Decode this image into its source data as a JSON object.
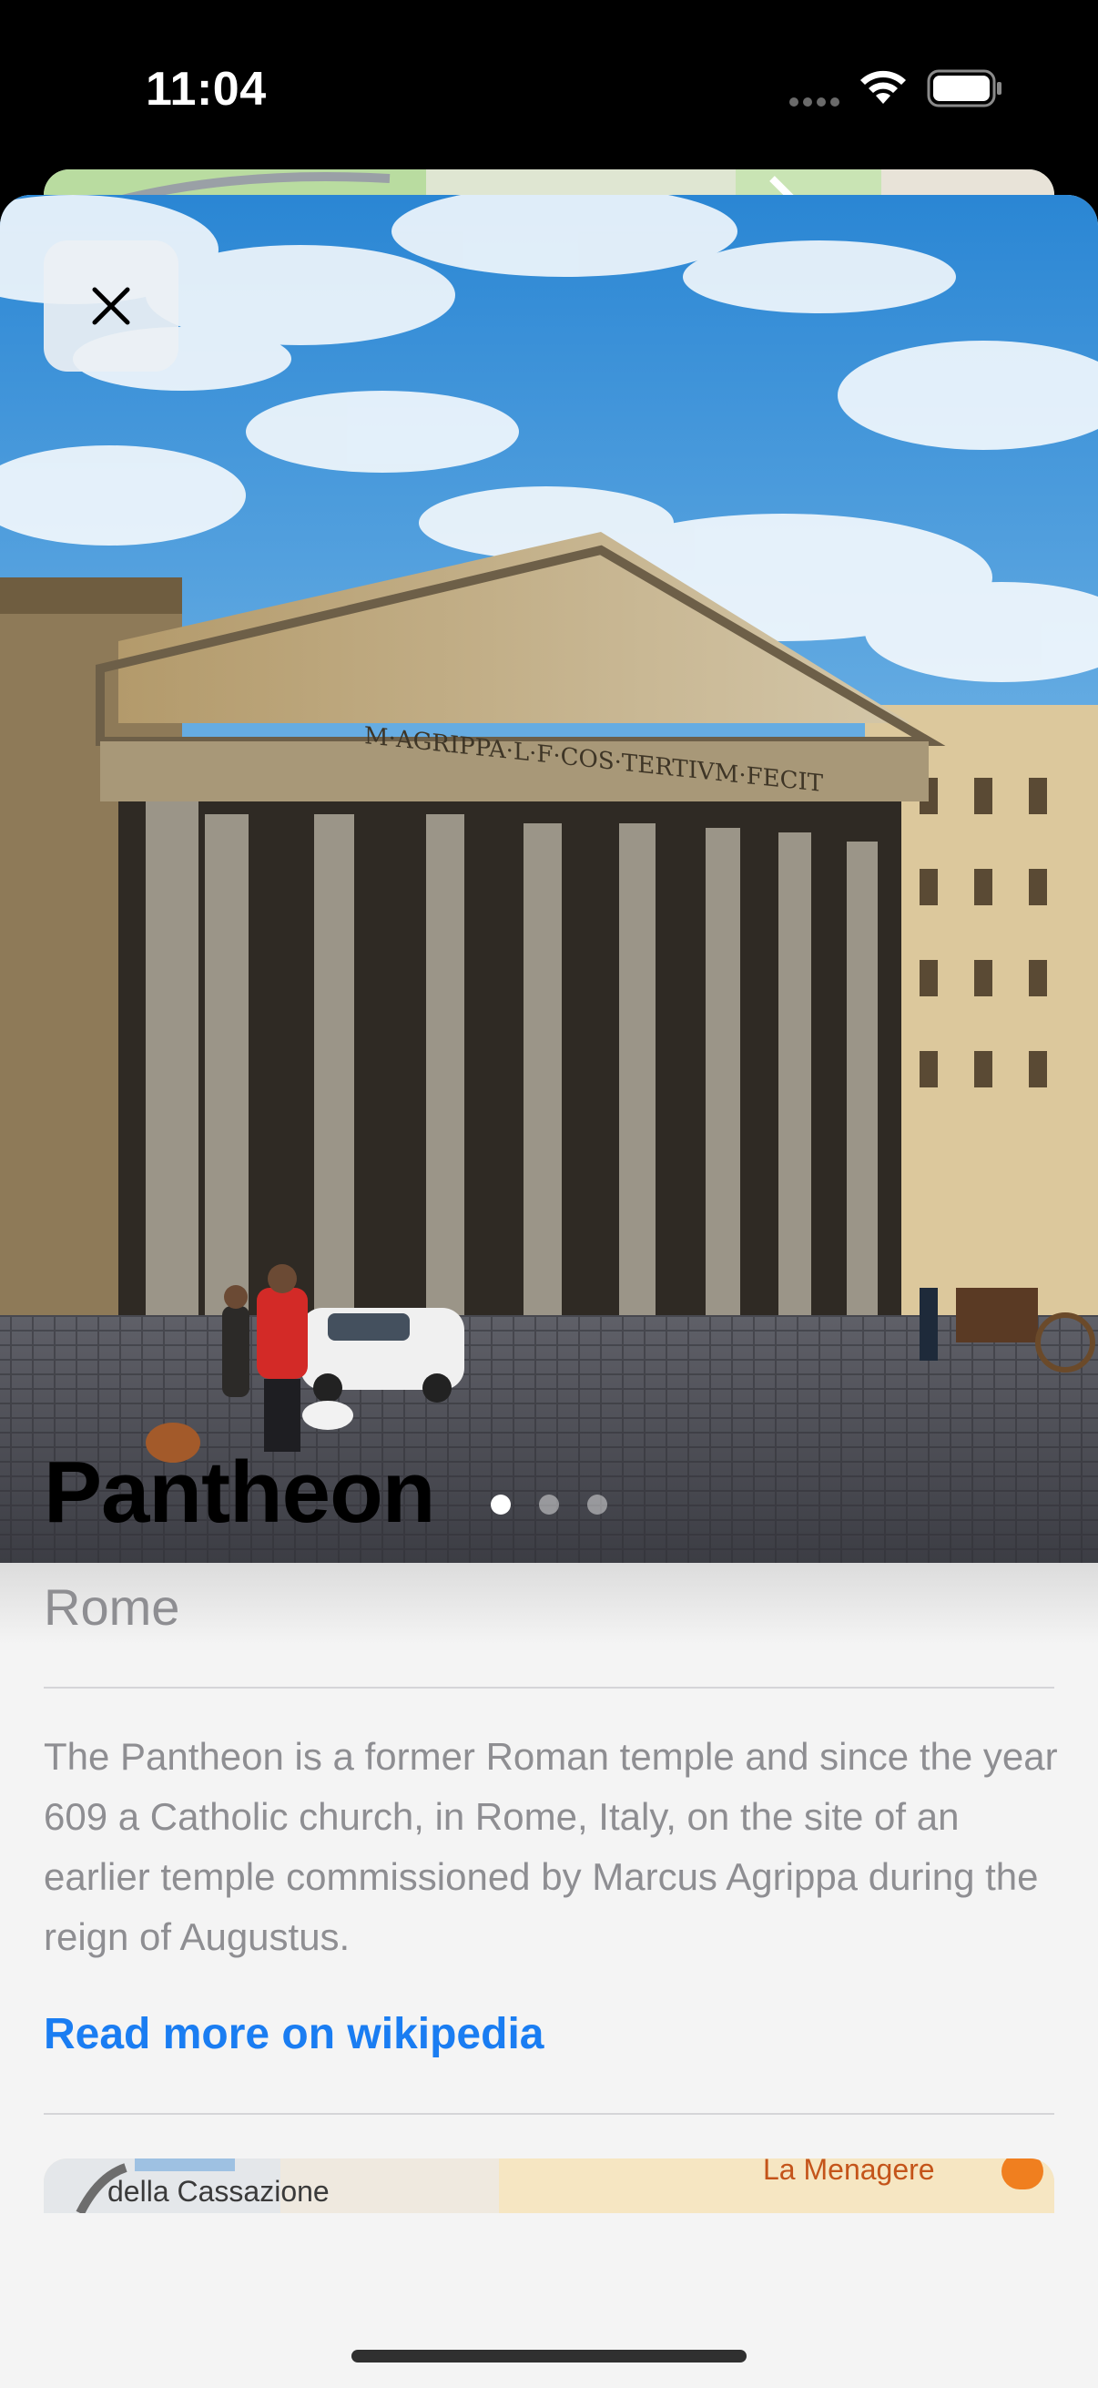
{
  "status_bar": {
    "time": "11:04",
    "wifi_icon": "wifi-icon",
    "battery_icon": "battery-icon",
    "signal_icon": "cellular-dots-icon"
  },
  "hero": {
    "close_icon": "close-icon",
    "page_count": 3,
    "active_page": 1,
    "inscription": "M·AGRIPPA·L·F·COS·TERTIVM·FECIT"
  },
  "place": {
    "name": "Pantheon",
    "city": "Rome",
    "description": "The Pantheon is a former Roman temple and since the year 609 a Catholic church, in Rome, Italy, on the site of an earlier temple commissioned by Marcus Agrippa during the reign of Augustus.",
    "link_label": "Read more on wikipedia"
  },
  "mini_map": {
    "label_left": "della Cassazione",
    "label_right": "La Menagere"
  },
  "colors": {
    "accent": "#1a7df2",
    "secondary_text": "#8e8e92",
    "sheet_background": "#f4f4f4"
  }
}
